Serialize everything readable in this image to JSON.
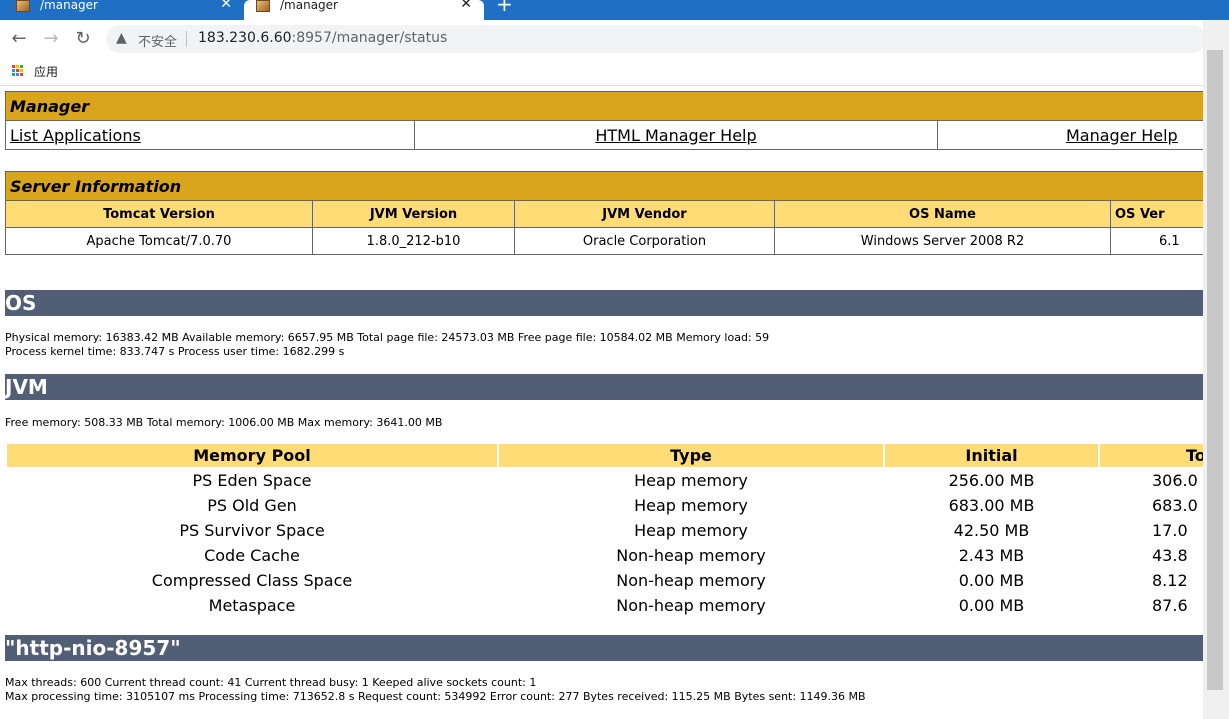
{
  "browser": {
    "tabs": [
      {
        "title": "/manager"
      },
      {
        "title": "/manager"
      }
    ],
    "new_tab": "+",
    "url_warning": "不安全",
    "url_host": "183.230.6.60",
    "url_path": ":8957/manager/status",
    "apps_label": "应用"
  },
  "manager": {
    "title": "Manager",
    "links": [
      "List Applications",
      "HTML Manager Help",
      "Manager Help"
    ]
  },
  "server_info": {
    "title": "Server Information",
    "headers": [
      "Tomcat Version",
      "JVM Version",
      "JVM Vendor",
      "OS Name",
      "OS Ver"
    ],
    "values": [
      "Apache Tomcat/7.0.70",
      "1.8.0_212-b10",
      "Oracle Corporation",
      "Windows Server 2008 R2",
      "6.1"
    ]
  },
  "os_section": {
    "title": "OS",
    "line1": "Physical memory: 16383.42 MB Available memory: 6657.95 MB Total page file: 24573.03 MB Free page file: 10584.02 MB Memory load: 59",
    "line2": "Process kernel time: 833.747 s Process user time: 1682.299 s"
  },
  "jvm_section": {
    "title": "JVM",
    "line1": "Free memory: 508.33 MB Total memory: 1006.00 MB Max memory: 3641.00 MB",
    "pool_headers": [
      "Memory Pool",
      "Type",
      "Initial",
      "To"
    ],
    "pools": [
      {
        "name": "PS Eden Space",
        "type": "Heap memory",
        "initial": "256.00 MB",
        "total": "306.0"
      },
      {
        "name": "PS Old Gen",
        "type": "Heap memory",
        "initial": "683.00 MB",
        "total": "683.0"
      },
      {
        "name": "PS Survivor Space",
        "type": "Heap memory",
        "initial": "42.50 MB",
        "total": "17.0"
      },
      {
        "name": "Code Cache",
        "type": "Non-heap memory",
        "initial": "2.43 MB",
        "total": "43.8"
      },
      {
        "name": "Compressed Class Space",
        "type": "Non-heap memory",
        "initial": "0.00 MB",
        "total": "8.12"
      },
      {
        "name": "Metaspace",
        "type": "Non-heap memory",
        "initial": "0.00 MB",
        "total": "87.6"
      }
    ]
  },
  "connector_section": {
    "title": "\"http-nio-8957\"",
    "line1": "Max threads: 600 Current thread count: 41 Current thread busy: 1 Keeped alive sockets count: 1",
    "line2": "Max processing time: 3105107 ms Processing time: 713652.8 s Request count: 534992 Error count: 277 Bytes received: 115.25 MB Bytes sent: 1149.36 MB"
  },
  "icons": {
    "back": "back-arrow-icon",
    "forward": "forward-arrow-icon",
    "reload": "reload-icon",
    "warning": "warning-icon",
    "apps": "apps-grid-icon",
    "tab_close": "close-icon",
    "favicon": "tomcat-favicon-icon"
  },
  "colors": {
    "tab_strip": "#1f6fc5",
    "title_bar": "#d8a51d",
    "header_cell": "#ffdc75",
    "section_bar": "#525d76"
  }
}
